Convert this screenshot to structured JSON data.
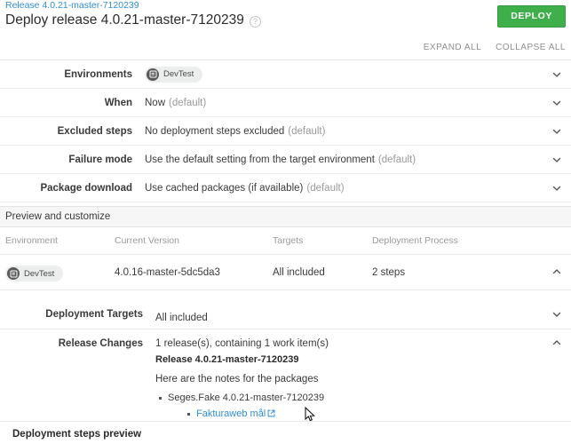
{
  "header": {
    "breadcrumb": "Release 4.0.21-master-7120239",
    "title": "Deploy release 4.0.21-master-7120239",
    "help_icon": "help-circle-icon",
    "deploy_label": "DEPLOY",
    "expand_all": "EXPAND ALL",
    "collapse_all": "COLLAPSE ALL",
    "accent_green": "#3eaf4a",
    "link_blue": "#2f8fd8"
  },
  "settings": [
    {
      "label": "Environments",
      "chip": {
        "label": "DevTest",
        "icon": "environment-icon"
      },
      "value": "",
      "default_note": "",
      "chevron": "chevron-down-icon"
    },
    {
      "label": "When",
      "value": "Now",
      "default_note": "(default)",
      "chevron": "chevron-down-icon"
    },
    {
      "label": "Excluded steps",
      "value": "No deployment steps excluded",
      "default_note": "(default)",
      "chevron": "chevron-down-icon"
    },
    {
      "label": "Failure mode",
      "value": "Use the default setting from the target environment",
      "default_note": "(default)",
      "chevron": "chevron-down-icon"
    },
    {
      "label": "Package download",
      "value": "Use cached packages (if available)",
      "default_note": "(default)",
      "chevron": "chevron-down-icon"
    }
  ],
  "preview": {
    "band_title": "Preview and customize",
    "columns": [
      "Environment",
      "Current Version",
      "Targets",
      "Deployment Process"
    ],
    "row": {
      "environment_chip": {
        "label": "DevTest",
        "icon": "environment-icon"
      },
      "current_version": "4.0.16-master-5dc5da3",
      "targets": "All included",
      "deployment_process": "2 steps",
      "chevron": "chevron-up-icon"
    }
  },
  "deployment_targets": {
    "label": "Deployment Targets",
    "value": "All included",
    "chevron": "chevron-down-icon"
  },
  "release_changes": {
    "label": "Release Changes",
    "summary": "1 release(s), containing 1 work item(s)",
    "release_name": "Release 4.0.21-master-7120239",
    "notes_intro": "Here are the notes for the packages",
    "package_item": "Seges.Fake 4.0.21-master-7120239",
    "work_item_link": "Fakturaweb mål",
    "work_item_link_icon": "external-link-icon",
    "chevron": "chevron-up-icon"
  },
  "footer": {
    "steps_preview_title": "Deployment steps preview"
  }
}
